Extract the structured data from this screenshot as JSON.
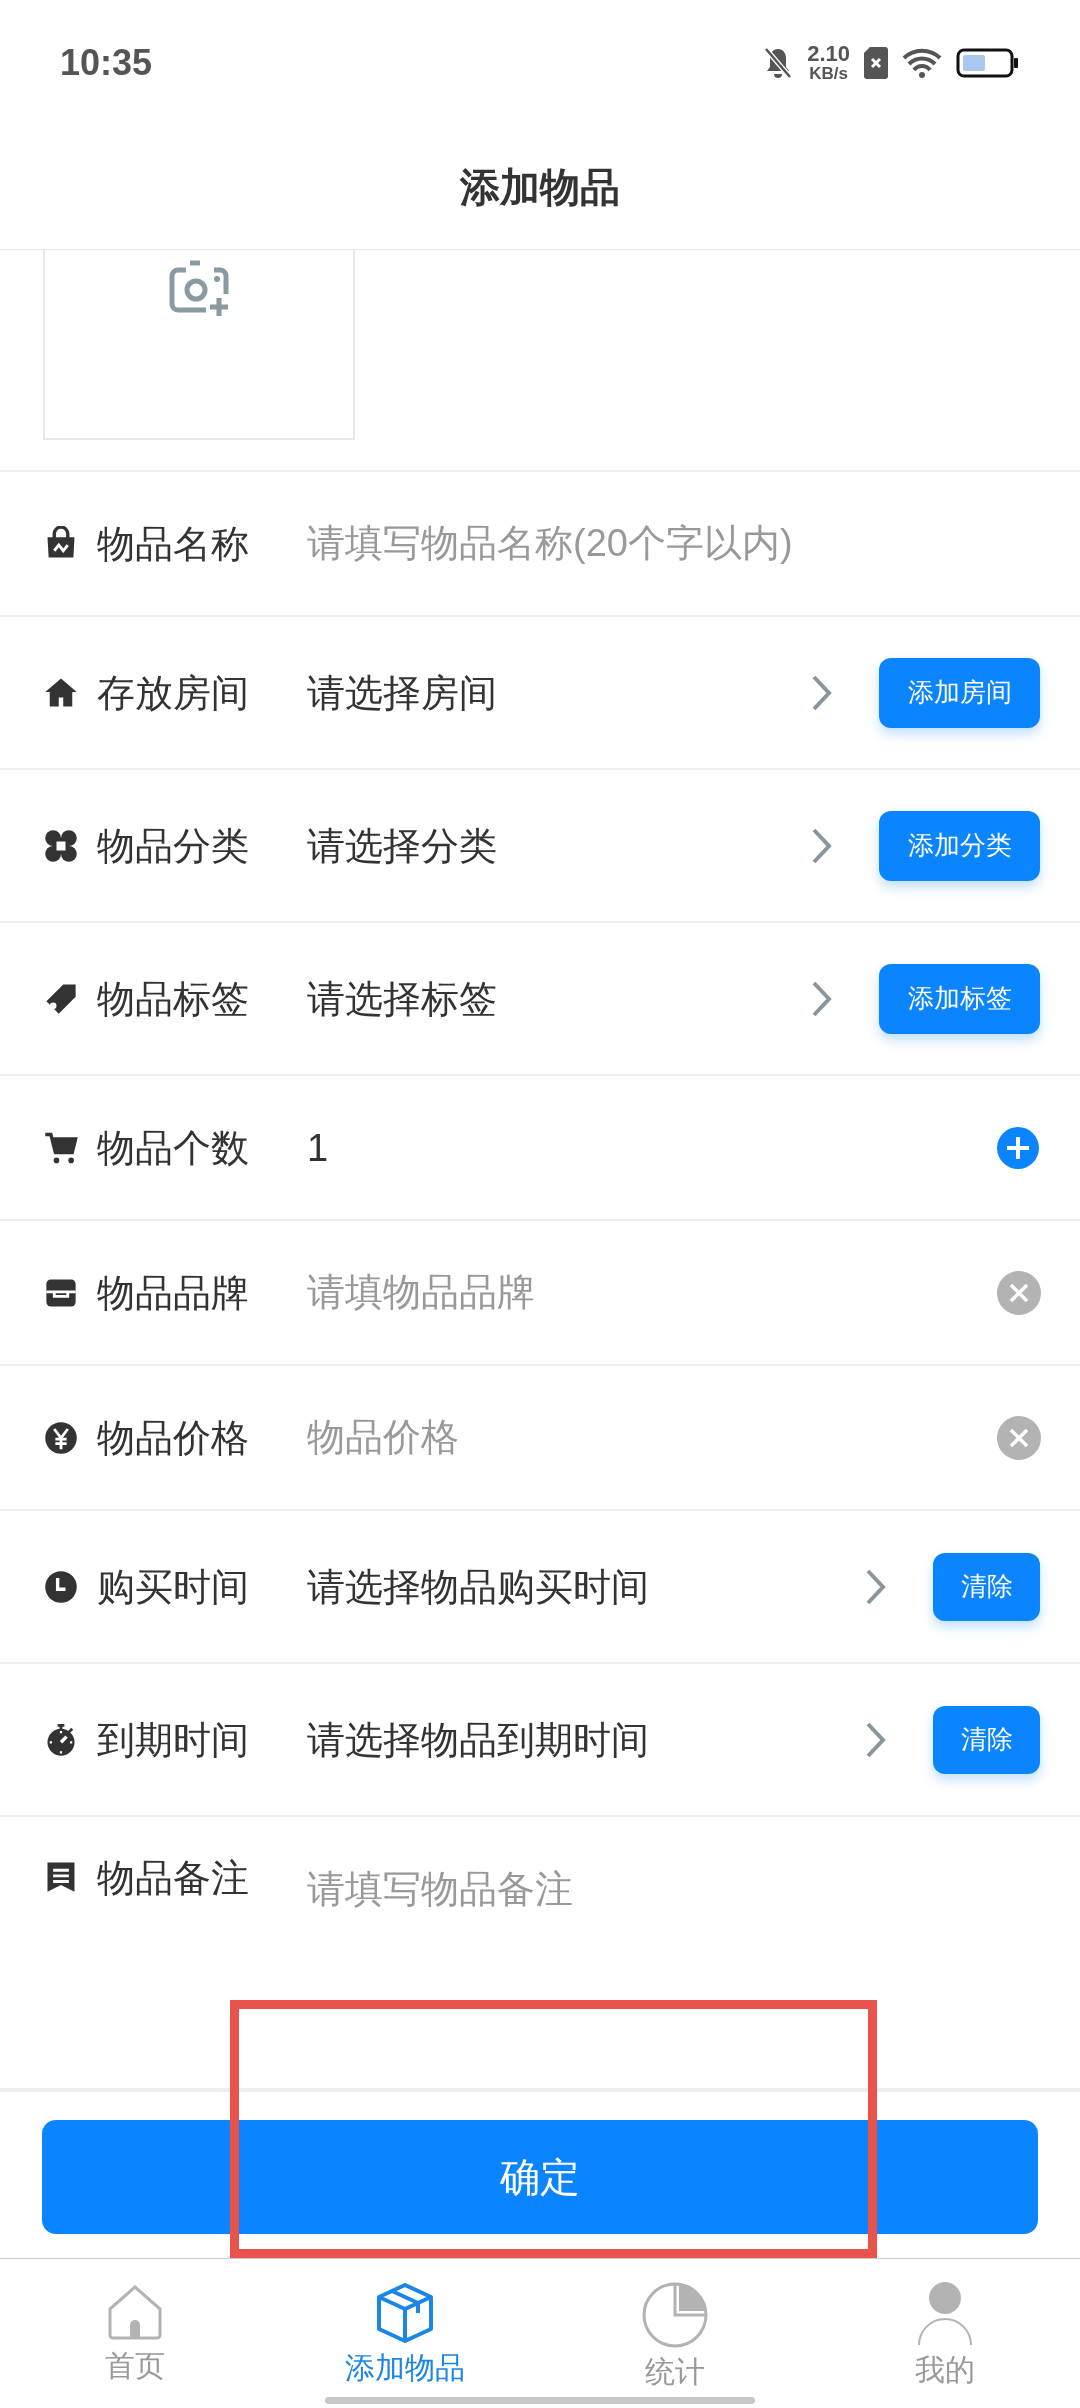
{
  "status_bar": {
    "time": "10:35",
    "speed_value": "2.10",
    "speed_unit": "KB/s"
  },
  "header": {
    "title": "添加物品"
  },
  "form": {
    "rows": [
      {
        "kind": "input",
        "label": "物品名称",
        "placeholder": "请填写物品名称(20个字以内)"
      },
      {
        "kind": "select",
        "label": "存放房间",
        "value": "请选择房间",
        "button": "添加房间"
      },
      {
        "kind": "select",
        "label": "物品分类",
        "value": "请选择分类",
        "button": "添加分类"
      },
      {
        "kind": "select",
        "label": "物品标签",
        "value": "请选择标签",
        "button": "添加标签"
      },
      {
        "kind": "stepper",
        "label": "物品个数",
        "value": "1"
      },
      {
        "kind": "clearable",
        "label": "物品品牌",
        "placeholder": "请填物品品牌"
      },
      {
        "kind": "clearable",
        "label": "物品价格",
        "placeholder": "物品价格"
      },
      {
        "kind": "date",
        "label": "购买时间",
        "value": "请选择物品购买时间",
        "button": "清除"
      },
      {
        "kind": "date",
        "label": "到期时间",
        "value": "请选择物品到期时间",
        "button": "清除"
      },
      {
        "kind": "textarea",
        "label": "物品备注",
        "placeholder": "请填写物品备注"
      }
    ]
  },
  "confirm_button": "确定",
  "tab_bar": [
    {
      "label": "首页",
      "selected": false
    },
    {
      "label": "添加物品",
      "selected": true
    },
    {
      "label": "统计",
      "selected": false
    },
    {
      "label": "我的",
      "selected": false
    }
  ]
}
